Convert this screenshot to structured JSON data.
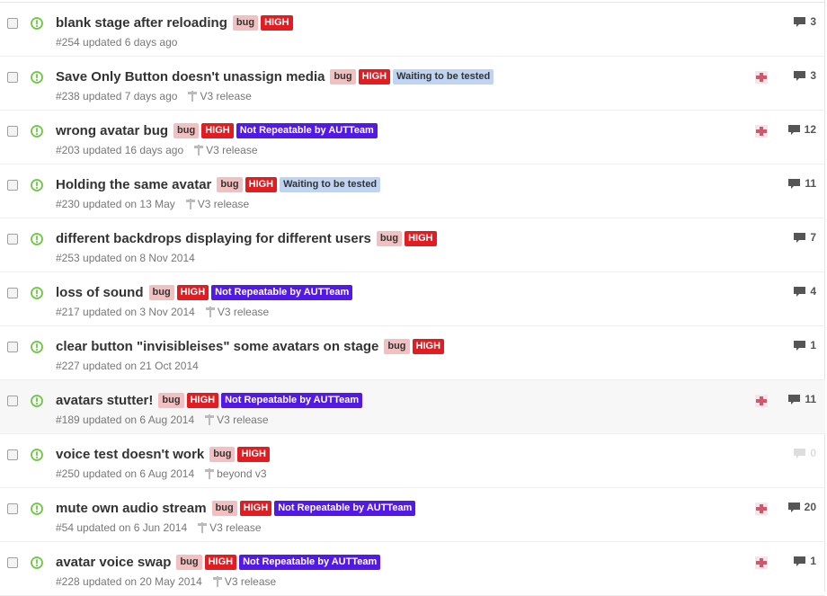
{
  "colors": {
    "open_state": "#6cc644",
    "label_bug": "#f2c0c0",
    "label_high": "#e11d21",
    "label_not_repeatable": "#5319e7",
    "label_waiting": "#bfd4f2"
  },
  "icons": {
    "state": "issue-opened-icon",
    "milestone": "milestone-icon",
    "comment": "comment-icon",
    "avatar": "assignee-avatar"
  },
  "issues": [
    {
      "title": "blank stage after reloading",
      "labels": [
        "bug",
        "HIGH"
      ],
      "meta": "#254 updated 6 days ago",
      "milestone": "",
      "comments": "3",
      "assignee": false
    },
    {
      "title": "Save Only Button doesn't unassign media",
      "labels": [
        "bug",
        "HIGH",
        "Waiting to be tested"
      ],
      "meta": "#238 updated 7 days ago",
      "milestone": "V3 release",
      "comments": "3",
      "assignee": true
    },
    {
      "title": "wrong avatar bug",
      "labels": [
        "bug",
        "HIGH",
        "Not Repeatable by AUTTeam"
      ],
      "meta": "#203 updated 16 days ago",
      "milestone": "V3 release",
      "comments": "12",
      "assignee": true
    },
    {
      "title": "Holding the same avatar",
      "labels": [
        "bug",
        "HIGH",
        "Waiting to be tested"
      ],
      "meta": "#230 updated on 13 May",
      "milestone": "V3 release",
      "comments": "11",
      "assignee": false
    },
    {
      "title": "different backdrops displaying for different users",
      "labels": [
        "bug",
        "HIGH"
      ],
      "meta": "#253 updated on 8 Nov 2014",
      "milestone": "",
      "comments": "7",
      "assignee": false
    },
    {
      "title": "loss of sound",
      "labels": [
        "bug",
        "HIGH",
        "Not Repeatable by AUTTeam"
      ],
      "meta": "#217 updated on 3 Nov 2014",
      "milestone": "V3 release",
      "comments": "4",
      "assignee": false
    },
    {
      "title": "clear button \"invisibleises\" some avatars on stage",
      "labels": [
        "bug",
        "HIGH"
      ],
      "meta": "#227 updated on 21 Oct 2014",
      "milestone": "",
      "comments": "1",
      "assignee": false
    },
    {
      "title": "avatars stutter!",
      "labels": [
        "bug",
        "HIGH",
        "Not Repeatable by AUTTeam"
      ],
      "meta": "#189 updated on 6 Aug 2014",
      "milestone": "V3 release",
      "comments": "11",
      "assignee": true
    },
    {
      "title": "voice test doesn't work",
      "labels": [
        "bug",
        "HIGH"
      ],
      "meta": "#250 updated on 6 Aug 2014",
      "milestone": "beyond v3",
      "comments": "0",
      "assignee": false
    },
    {
      "title": "mute own audio stream",
      "labels": [
        "bug",
        "HIGH",
        "Not Repeatable by AUTTeam"
      ],
      "meta": "#54 updated on 6 Jun 2014",
      "milestone": "V3 release",
      "comments": "20",
      "assignee": true
    },
    {
      "title": "avatar voice swap",
      "labels": [
        "bug",
        "HIGH",
        "Not Repeatable by AUTTeam"
      ],
      "meta": "#228 updated on 20 May 2014",
      "milestone": "V3 release",
      "comments": "1",
      "assignee": true
    }
  ]
}
